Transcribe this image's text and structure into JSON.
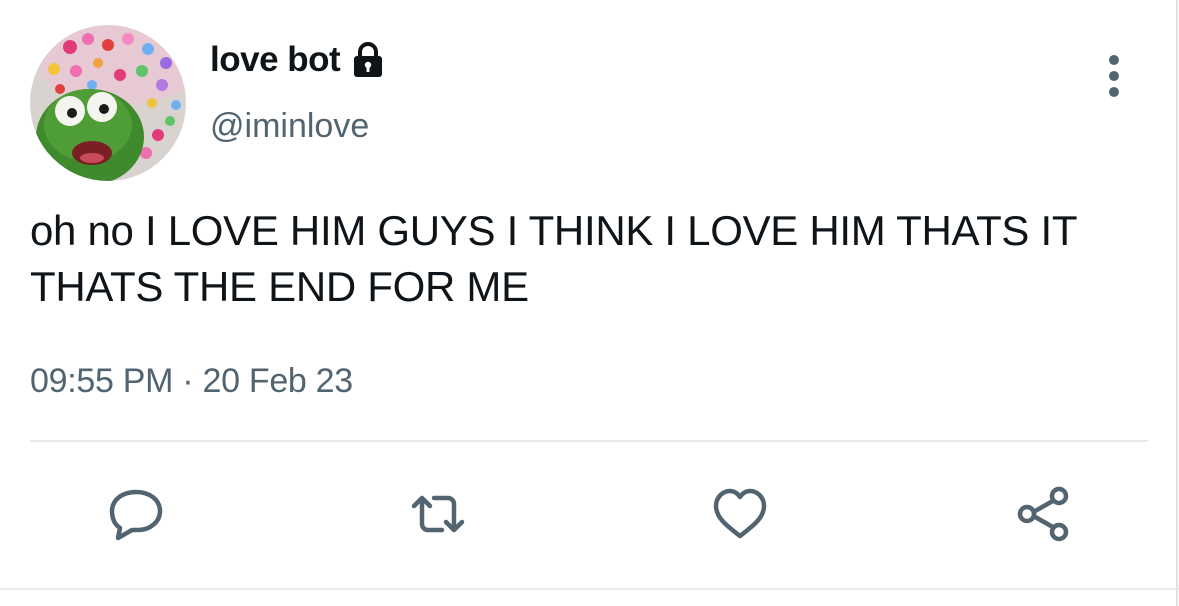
{
  "user": {
    "display_name": "love bot",
    "handle": "@iminlove",
    "avatar": "kermit-hearts-avatar",
    "protected_icon": "lock-icon"
  },
  "tweet": {
    "text": "oh no I LOVE HIM GUYS I THINK I LOVE HIM THATS IT THATS THE END FOR ME",
    "time": "09:55 PM",
    "separator": "·",
    "date": "20 Feb 23"
  },
  "actions": [
    {
      "icon": "reply-icon"
    },
    {
      "icon": "retweet-icon"
    },
    {
      "icon": "like-icon"
    },
    {
      "icon": "share-icon"
    }
  ],
  "more_icon": "more-vertical-icon",
  "colors": {
    "text_primary": "#0f1419",
    "text_secondary": "#536471",
    "icon_gray": "#536471",
    "divider": "#e6e9eb"
  }
}
